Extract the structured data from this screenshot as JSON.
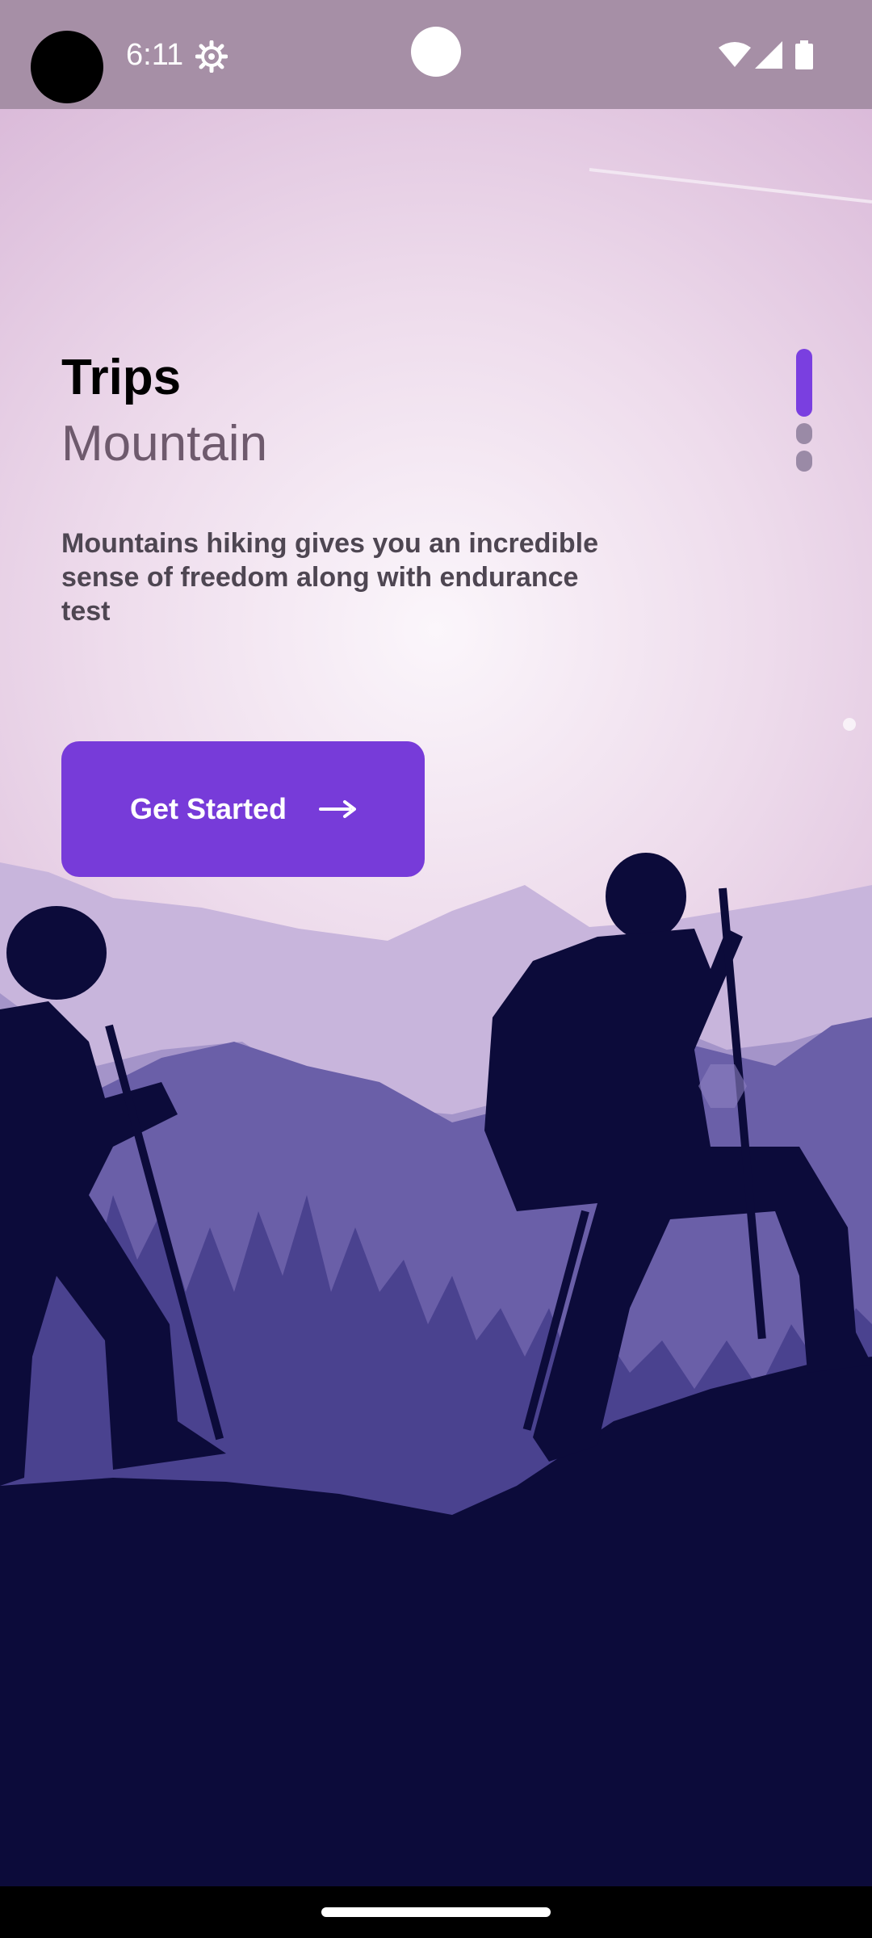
{
  "status_bar": {
    "time": "6:11",
    "icons": [
      "settings-icon",
      "wifi-icon",
      "signal-icon",
      "battery-icon"
    ]
  },
  "onboarding": {
    "title": "Trips",
    "subtitle": "Mountain",
    "description": "Mountains hiking gives you an incredible sense of freedom along with endurance test",
    "cta_label": "Get Started",
    "cta_icon": "arrow-right-icon",
    "page_count": 3,
    "current_page": 1
  },
  "illustration": {
    "subject": "hikers-silhouette-illustration"
  },
  "colors": {
    "accent": "#773bd9",
    "background_dark": "#0c0b3a",
    "status_bar": "#a68fa6"
  }
}
